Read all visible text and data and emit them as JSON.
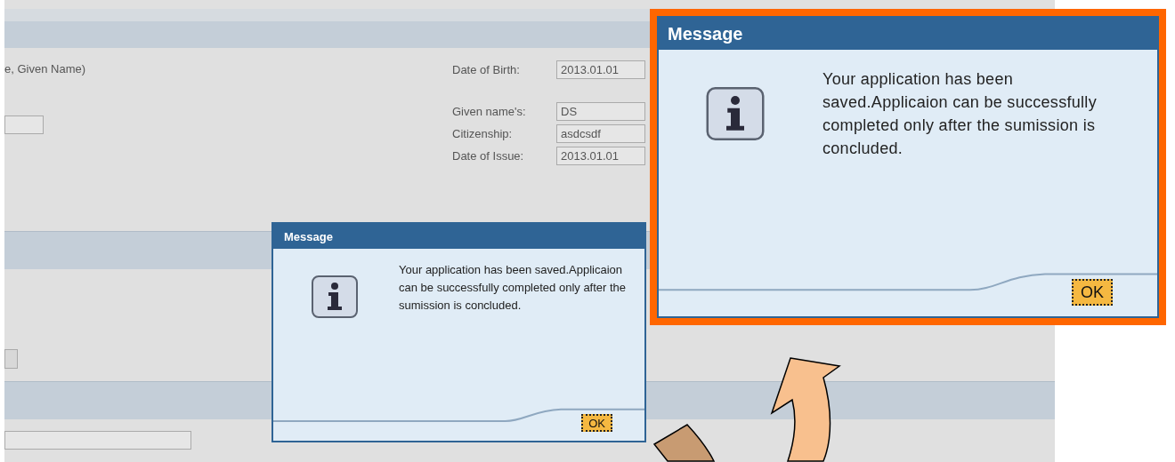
{
  "form": {
    "name_hint": "e, Given Name)",
    "fields": [
      {
        "label": "Date of Birth:",
        "value": "2013.01.01"
      },
      {
        "label": "Given name's:",
        "value": "DS"
      },
      {
        "label": "Citizenship:",
        "value": "asdcsdf"
      },
      {
        "label": "Date of Issue:",
        "value": "2013.01.01"
      }
    ]
  },
  "dialogs": [
    {
      "title": "Message",
      "message": "Your application has been saved.Applicaion can be successfully completed only after the sumission is concluded.",
      "button": "OK",
      "zoomed": false
    },
    {
      "title": "Message",
      "message": "Your application has been saved.Applicaion can be successfully completed only after the sumission is concluded.",
      "button": "OK",
      "zoomed": true
    }
  ]
}
